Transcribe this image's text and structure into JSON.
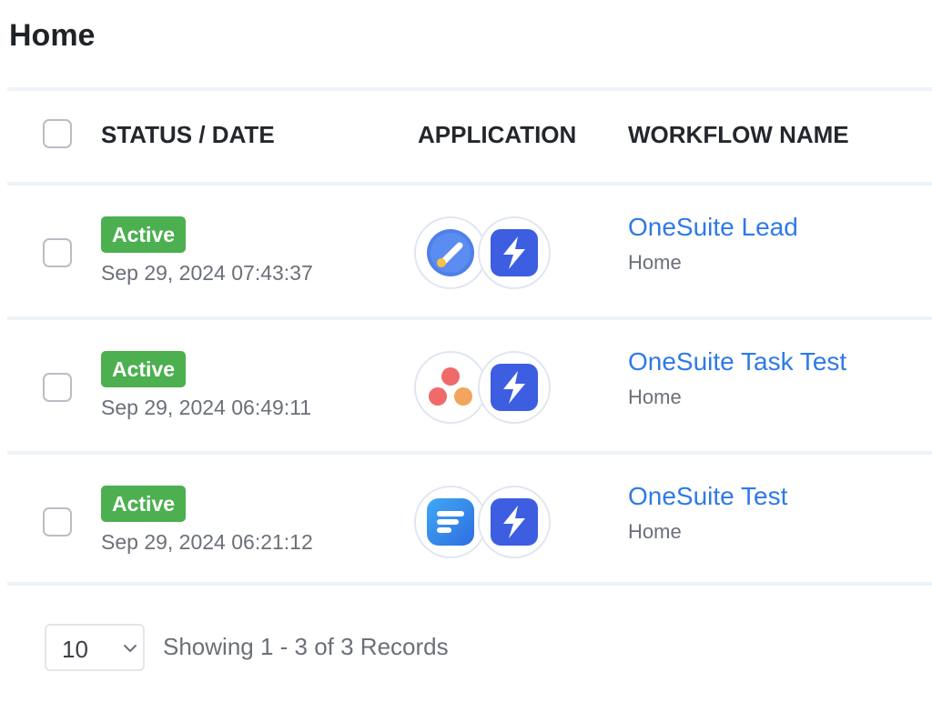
{
  "page": {
    "title": "Home"
  },
  "table": {
    "headers": {
      "status_date": "STATUS / DATE",
      "application": "APPLICATION",
      "workflow_name": "WORKFLOW NAME"
    },
    "rows": [
      {
        "status": "Active",
        "date": "Sep 29, 2024 07:43:37",
        "apps": [
          "google-tasks-icon",
          "lightning-app-icon"
        ],
        "workflow_name": "OneSuite Lead",
        "workflow_sub": "Home"
      },
      {
        "status": "Active",
        "date": "Sep 29, 2024 06:49:11",
        "apps": [
          "asana-icon",
          "lightning-app-icon"
        ],
        "workflow_name": "OneSuite Task Test",
        "workflow_sub": "Home"
      },
      {
        "status": "Active",
        "date": "Sep 29, 2024 06:21:12",
        "apps": [
          "stack-lines-app-icon",
          "lightning-app-icon"
        ],
        "workflow_name": "OneSuite Test",
        "workflow_sub": "Home"
      }
    ]
  },
  "footer": {
    "page_size": "10",
    "records_text": "Showing 1 - 3 of 3 Records"
  },
  "colors": {
    "status_active": "#4caf50",
    "link": "#2f7ae6",
    "lightning_bg": "#3d5ee0",
    "asana": "#f06a6a",
    "google_tasks": "#4f7fe8"
  }
}
